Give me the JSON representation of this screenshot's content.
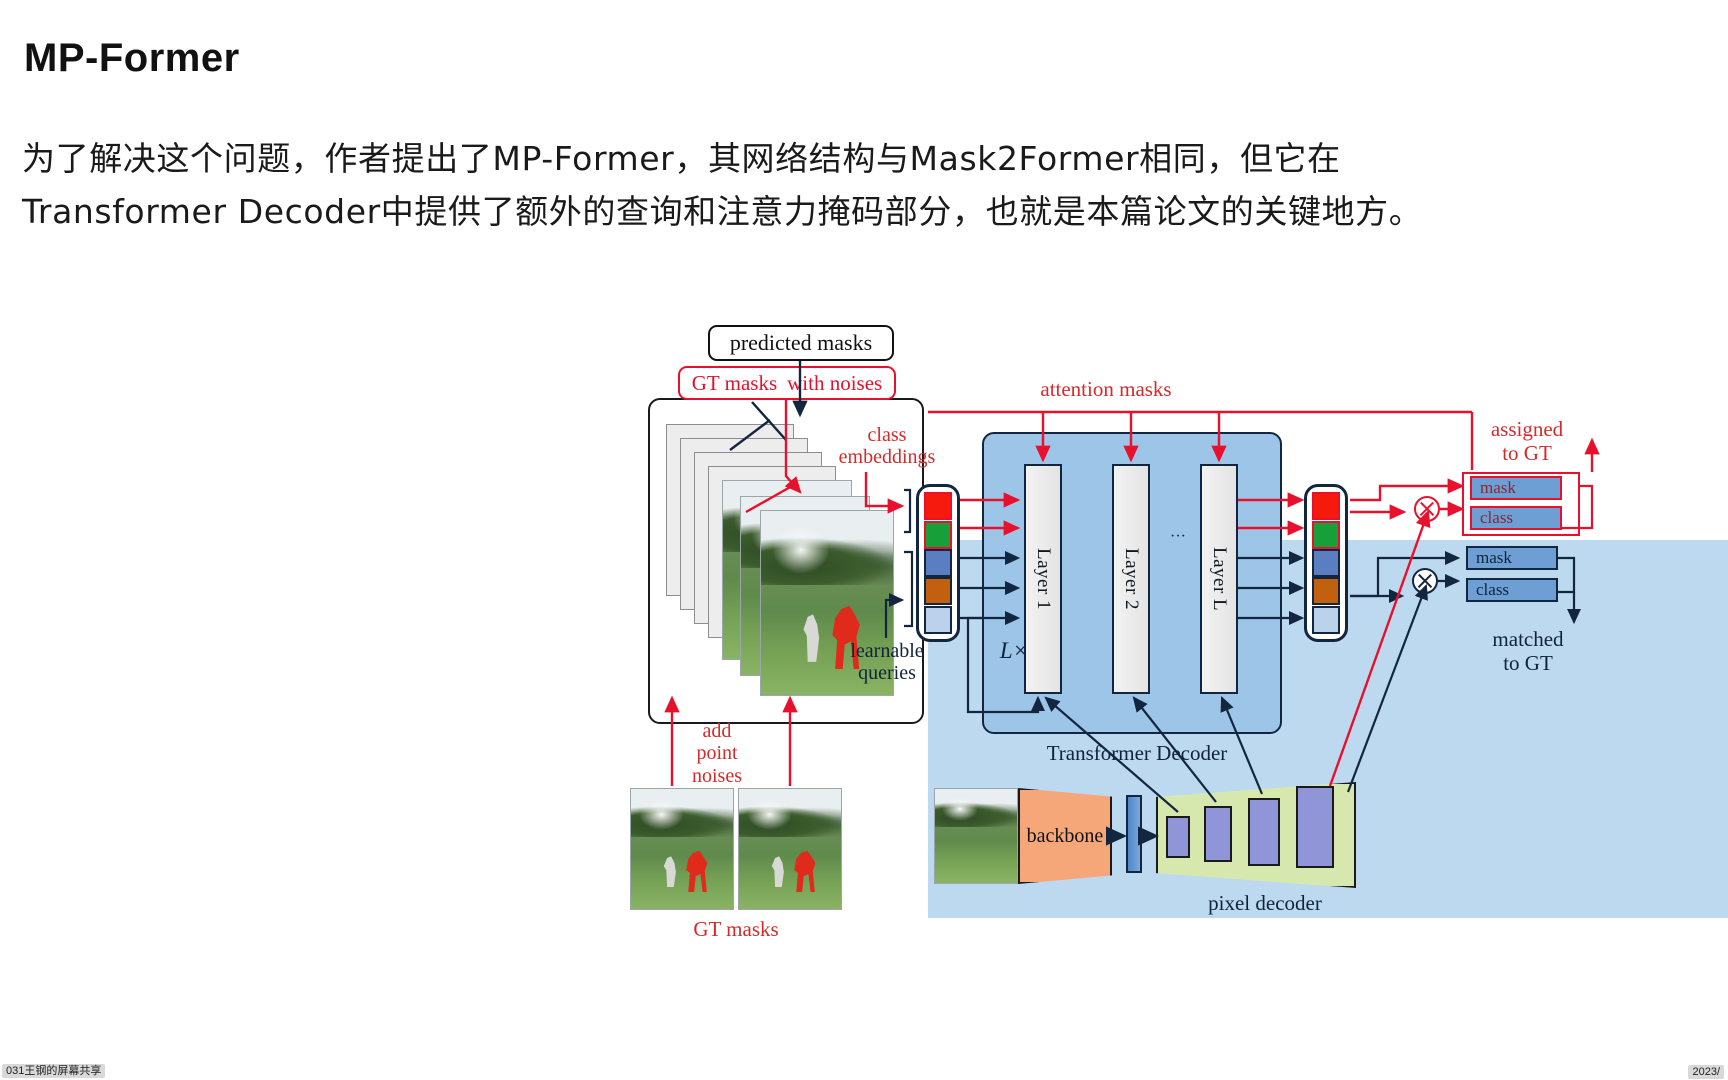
{
  "slide": {
    "title": "MP-Former",
    "paragraph_lines": [
      "为了解决这个问题，作者提出了MP-Former，其网络结构与Mask2Former相同，但它在",
      "Transformer Decoder中提供了额外的查询和注意力掩码部分，也就是本篇论文的关键地方。"
    ]
  },
  "figure": {
    "labels": {
      "predicted_masks": "predicted masks",
      "gt_masks_with_noises_left": "GT masks",
      "gt_masks_with_noises_right": "with noises",
      "attention_masks": "attention masks",
      "class_embeddings": "class\nembeddings",
      "learnable_queries": "learnable\nqueries",
      "transformer_decoder": "Transformer Decoder",
      "l_times": "L×",
      "layer_1": "Layer 1",
      "layer_2": "Layer 2",
      "layer_L": "Layer L",
      "ellipsis": "···",
      "assigned_to_gt": "assigned\nto GT",
      "matched_to_gt": "matched\nto GT",
      "mask_top": "mask",
      "class_top": "class",
      "mask_bottom": "mask",
      "class_bottom": "class",
      "add_point_noises": "add\npoint\nnoises",
      "gt_masks_bottom": "GT masks",
      "backbone": "backbone",
      "pixel_decoder": "pixel decoder"
    },
    "colors": {
      "noise_query_1": "#f61a0d",
      "noise_query_2": "#17a03a",
      "learnable_query_1": "#5a7ec0",
      "learnable_query_2": "#c1610f",
      "learnable_query_3": "#bcd2ec",
      "red_accent": "#e8112d",
      "panel_blue": "#bcd9f0",
      "backbone_orange": "#f5a77a",
      "pixel_decoder_green": "#d7e8ae",
      "feature_purple": "#8f95d6",
      "pill_blue": "#6e9fd4"
    }
  },
  "statusbar": {
    "left_text": "031王钢的屏幕共享",
    "right_text": "2023/"
  }
}
